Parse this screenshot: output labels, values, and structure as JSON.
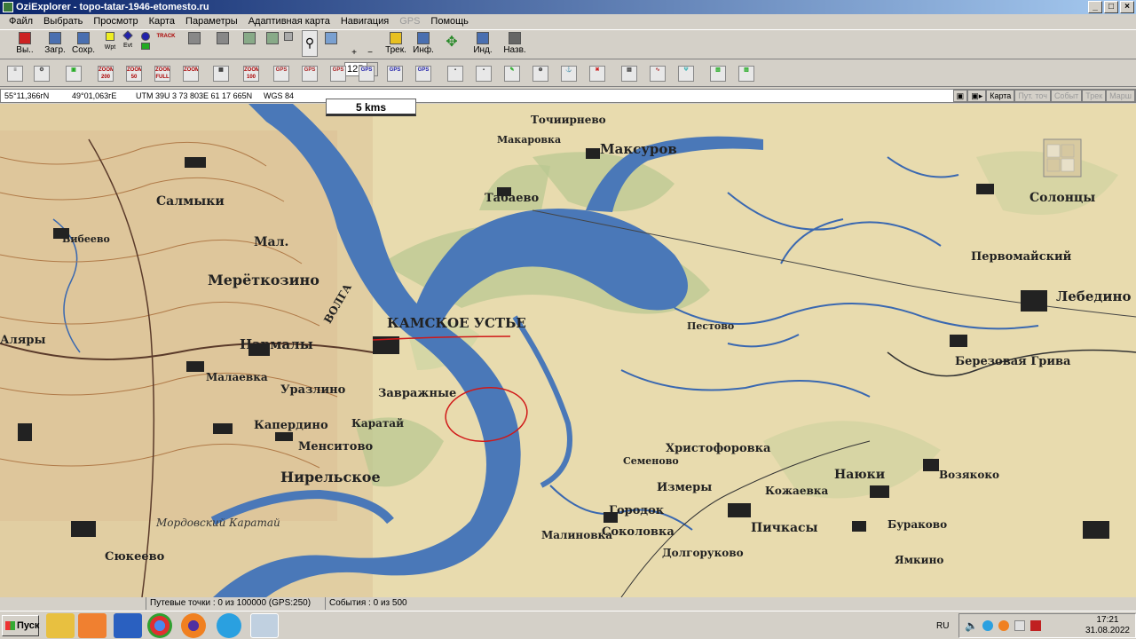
{
  "window": {
    "title": "OziExplorer  -  topo-tatar-1946-etomesto.ru"
  },
  "menu": [
    "Файл",
    "Выбрать",
    "Просмотр",
    "Карта",
    "Параметры",
    "Адаптивная карта",
    "Навигация",
    "GPS",
    "Помощь"
  ],
  "toolbar": {
    "exit_label": "Вы..",
    "load_label": "Загр.",
    "save_label": "Сохр.",
    "wpt_label": "Wpt",
    "evt_label": "Evt",
    "track_label": "TRACK",
    "zoom_value": "125",
    "track_btn_label": "Трек.",
    "info_label": "Инф.",
    "ind_label": "Инд.",
    "name_label": "Назв."
  },
  "toolbar2": {
    "zoom200": "ZOOM 200",
    "zoom50": "ZOOM 50",
    "zoom_full": "ZOOM FULL",
    "zoom100": "ZOOM 100",
    "gps": "GPS"
  },
  "infobar": {
    "lat": "55°11,366гN",
    "lon": "49°01,063гE",
    "utm": "UTM  39U   3 73 803E   61 17 665N",
    "datum": "WGS 84",
    "btn_map": "Карта",
    "btn_waypoints": "Пут. точ",
    "btn_events": "Событ",
    "btn_track": "Трек",
    "btn_routes": "Марш"
  },
  "scale": "5 kms",
  "map_labels": {
    "kamskoe_ustie": "КАМСКОЕ УСТЬЕ",
    "maksurovo": "Максуров",
    "makarovka": "Макаровка",
    "tabaevo": "Табаево",
    "tochiripnevo": "Точиирнево",
    "meretkozino": "Мерёткозино",
    "mal": "Мал.",
    "narmaly": "Нармалы",
    "malaevka": "Малаевка",
    "urazlino": "Уразлино",
    "zavrazhnye": "Завражные",
    "karatai": "Каратай",
    "kaperdino": "Капердино",
    "mensitovo": "Менситово",
    "nireliskoe": "Нирельское",
    "murzikha": "Мордовский Каратай",
    "syukeevo": "Сюкеево",
    "solontsy": "Солонцы",
    "lebedino": "Лебедино",
    "pervomaiskii": "Первомайский",
    "berezovaya_griva": "Березовая Грива",
    "hristoforovka": "Христофоровка",
    "izmery": "Измеры",
    "naiuki": "Наюки",
    "vozyakovo": "Возякоко",
    "pichkasy": "Пичкасы",
    "burakovo": "Бураково",
    "gorodok": "Городок",
    "sokolovka": "Соколовка",
    "malinovka": "Малиновка",
    "dolgorukovo": "Долгоруково",
    "semenovo": "Семеново",
    "pestovo": "Пестово",
    "alyary": "Аляры",
    "salmyki": "Салмыки",
    "bibeevo": "Бибеево",
    "yamkino": "Ямкино",
    "kozhaevka": "Кожаевка",
    "volga": "ВОЛГА"
  },
  "status": {
    "waypoints": "Путевые точки : 0 из 100000  (GPS:250)",
    "events": "События : 0 из 500"
  },
  "taskbar": {
    "start": "Пуск",
    "lang": "RU",
    "time": "17:21",
    "date": "31.08.2022"
  }
}
